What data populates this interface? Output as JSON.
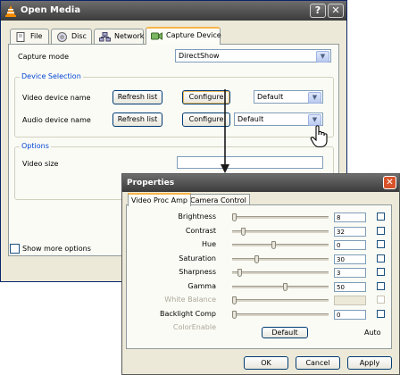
{
  "open_media": {
    "title": "Open Media",
    "help_symbol": "?",
    "close_symbol": "✕",
    "tabs": [
      {
        "label": "File",
        "icon": "file-icon"
      },
      {
        "label": "Disc",
        "icon": "disc-icon"
      },
      {
        "label": "Network",
        "icon": "network-icon"
      },
      {
        "label": "Capture Device",
        "icon": "capture-device-icon"
      }
    ],
    "capture_mode_label": "Capture mode",
    "capture_mode_value": "DirectShow",
    "device_selection_title": "Device Selection",
    "video_device_label": "Video device name",
    "audio_device_label": "Audio device name",
    "refresh_list_label": "Refresh list",
    "configure_label": "Configure",
    "video_device_value": "Default",
    "audio_device_value": "Default",
    "options_title": "Options",
    "video_size_label": "Video size",
    "video_size_value": "",
    "show_more_options_label": "Show more options",
    "show_more_options_checked": false
  },
  "properties": {
    "title": "Properties",
    "close_symbol": "✕",
    "tabs": [
      "Video Proc Amp",
      "Camera Control"
    ],
    "rows": [
      {
        "label": "Brightness",
        "value": "8",
        "level": 0.0,
        "enabled": true
      },
      {
        "label": "Contrast",
        "value": "32",
        "level": 0.1,
        "enabled": true
      },
      {
        "label": "Hue",
        "value": "0",
        "level": 0.43,
        "enabled": true
      },
      {
        "label": "Saturation",
        "value": "30",
        "level": 0.24,
        "enabled": true
      },
      {
        "label": "Sharpness",
        "value": "3",
        "level": 0.06,
        "enabled": true
      },
      {
        "label": "Gamma",
        "value": "50",
        "level": 0.55,
        "enabled": true
      },
      {
        "label": "White Balance",
        "value": "",
        "level": 0.0,
        "enabled": false
      },
      {
        "label": "Backlight Comp",
        "value": "0",
        "level": 0.0,
        "enabled": true
      },
      {
        "label": "ColorEnable",
        "value": "",
        "level": null,
        "enabled": false
      }
    ],
    "default_label": "Default",
    "auto_label": "Auto",
    "ok_label": "OK",
    "cancel_label": "Cancel",
    "apply_label": "Apply"
  },
  "colors": {
    "titlebar": "#3b3b3b",
    "group_title": "#0046d5",
    "window_bg": "#ece9d8",
    "arrow": "#1a1a1a",
    "close_red": "#d8532a"
  }
}
